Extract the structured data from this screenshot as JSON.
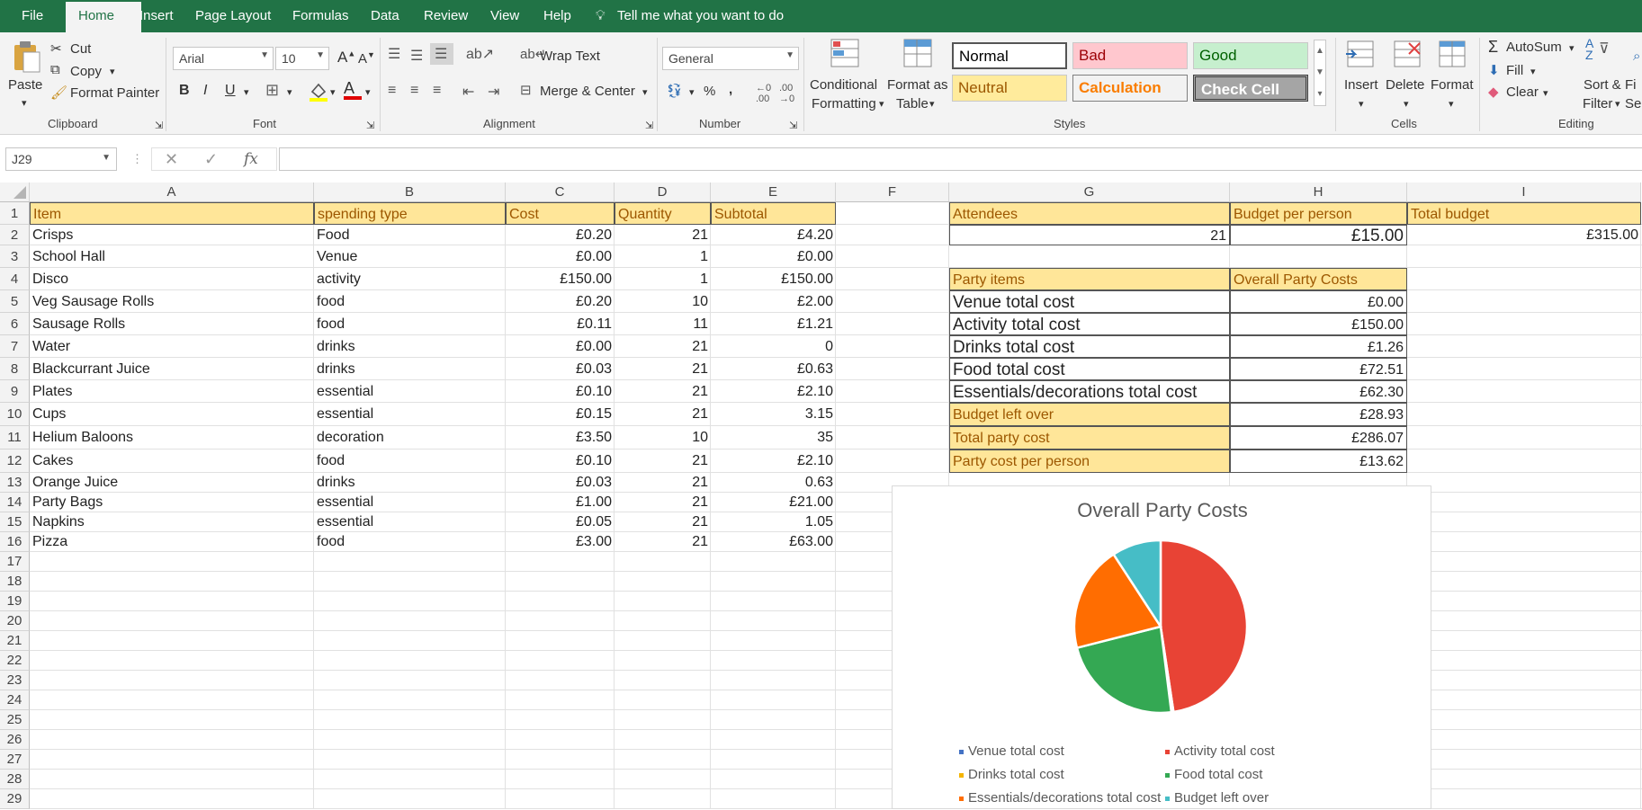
{
  "menu": {
    "file": "File",
    "home": "Home",
    "insert": "Insert",
    "page_layout": "Page Layout",
    "formulas": "Formulas",
    "data": "Data",
    "review": "Review",
    "view": "View",
    "help": "Help",
    "tell_me": "Tell me what you want to do"
  },
  "ribbon": {
    "clipboard": {
      "paste": "Paste",
      "cut": "Cut",
      "copy": "Copy",
      "format_painter": "Format Painter",
      "label": "Clipboard"
    },
    "font": {
      "name": "Arial",
      "size": "10",
      "label": "Font"
    },
    "alignment": {
      "wrap": "Wrap Text",
      "merge": "Merge & Center",
      "label": "Alignment"
    },
    "number": {
      "format": "General",
      "label": "Number"
    },
    "styles": {
      "cond_line1": "Conditional",
      "cond_line2": "Formatting",
      "fmt_line1": "Format as",
      "fmt_line2": "Table",
      "normal": "Normal",
      "bad": "Bad",
      "good": "Good",
      "neutral": "Neutral",
      "calculation": "Calculation",
      "check_cell": "Check Cell",
      "label": "Styles"
    },
    "cells": {
      "insert": "Insert",
      "delete": "Delete",
      "format": "Format",
      "label": "Cells"
    },
    "editing": {
      "autosum": "AutoSum",
      "fill": "Fill",
      "clear": "Clear",
      "sort_line1": "Sort &",
      "sort_line2": "Filter",
      "find_line1": "Fi",
      "find_line2": "Sel",
      "label": "Editing"
    }
  },
  "formula_bar": {
    "name_box": "J29",
    "fx": "fx",
    "content": ""
  },
  "columns": [
    "A",
    "B",
    "C",
    "D",
    "E",
    "F",
    "G",
    "H",
    "I"
  ],
  "rows": [
    "1",
    "2",
    "3",
    "4",
    "5",
    "6",
    "7",
    "8",
    "9",
    "10",
    "11",
    "12",
    "13",
    "14",
    "15",
    "16",
    "17",
    "18",
    "19",
    "20",
    "21",
    "22",
    "23",
    "24",
    "25",
    "26",
    "27",
    "28",
    "29"
  ],
  "items_table": {
    "headers": [
      "Item",
      "spending type",
      "Cost",
      "Quantity",
      "Subtotal"
    ],
    "rows": [
      [
        "Crisps",
        "Food",
        "£0.20",
        "21",
        "£4.20"
      ],
      [
        " School Hall",
        "Venue",
        "£0.00",
        "1",
        "£0.00"
      ],
      [
        "Disco",
        "activity",
        "£150.00",
        "1",
        "£150.00"
      ],
      [
        "Veg Sausage Rolls",
        "food",
        "£0.20",
        "10",
        "£2.00"
      ],
      [
        "Sausage Rolls",
        "food",
        "£0.11",
        "11",
        "£1.21"
      ],
      [
        "Water",
        "drinks",
        "£0.00",
        "21",
        "0"
      ],
      [
        "Blackcurrant Juice",
        "drinks",
        "£0.03",
        "21",
        "£0.63"
      ],
      [
        "Plates",
        "essential",
        "£0.10",
        "21",
        "£2.10"
      ],
      [
        "Cups",
        "essential",
        "£0.15",
        "21",
        "3.15"
      ],
      [
        "Helium Baloons",
        "decoration",
        "£3.50",
        "10",
        "35"
      ],
      [
        "Cakes",
        "food",
        "£0.10",
        "21",
        "£2.10"
      ],
      [
        "Orange Juice",
        "drinks",
        "£0.03",
        "21",
        "0.63"
      ],
      [
        "Party Bags",
        "essential",
        "£1.00",
        "21",
        "£21.00"
      ],
      [
        "Napkins",
        "essential",
        "£0.05",
        "21",
        "1.05"
      ],
      [
        "Pizza",
        "food",
        "£3.00",
        "21",
        "£63.00"
      ]
    ]
  },
  "budget": {
    "attendees_label": "Attendees",
    "per_person_label": "Budget per person",
    "total_label": "Total budget",
    "attendees": "21",
    "per_person": "£15.00",
    "total": "£315.00"
  },
  "summary": {
    "header_items": "Party items",
    "header_costs": "Overall Party Costs",
    "rows": [
      [
        "Venue total cost",
        "£0.00"
      ],
      [
        "Activity total cost",
        "£150.00"
      ],
      [
        "Drinks total cost",
        "£1.26"
      ],
      [
        "Food total cost",
        "£72.51"
      ],
      [
        "Essentials/decorations total cost",
        "£62.30"
      ],
      [
        "Budget left over",
        "£28.93"
      ],
      [
        "Total party cost",
        "£286.07"
      ],
      [
        "Party cost per person",
        "£13.62"
      ]
    ]
  },
  "chart_data": {
    "type": "pie",
    "title": "Overall Party Costs",
    "categories": [
      "Venue total cost",
      "Activity total cost",
      "Drinks total cost",
      "Food total cost",
      "Essentials/decorations total cost",
      "Budget left over"
    ],
    "values": [
      0,
      150,
      1.26,
      72.51,
      62.3,
      28.93
    ],
    "colors": [
      "#4472c4",
      "#e84335",
      "#f4b400",
      "#34a853",
      "#ff6d01",
      "#46bdc6"
    ],
    "legend": "bottom"
  }
}
